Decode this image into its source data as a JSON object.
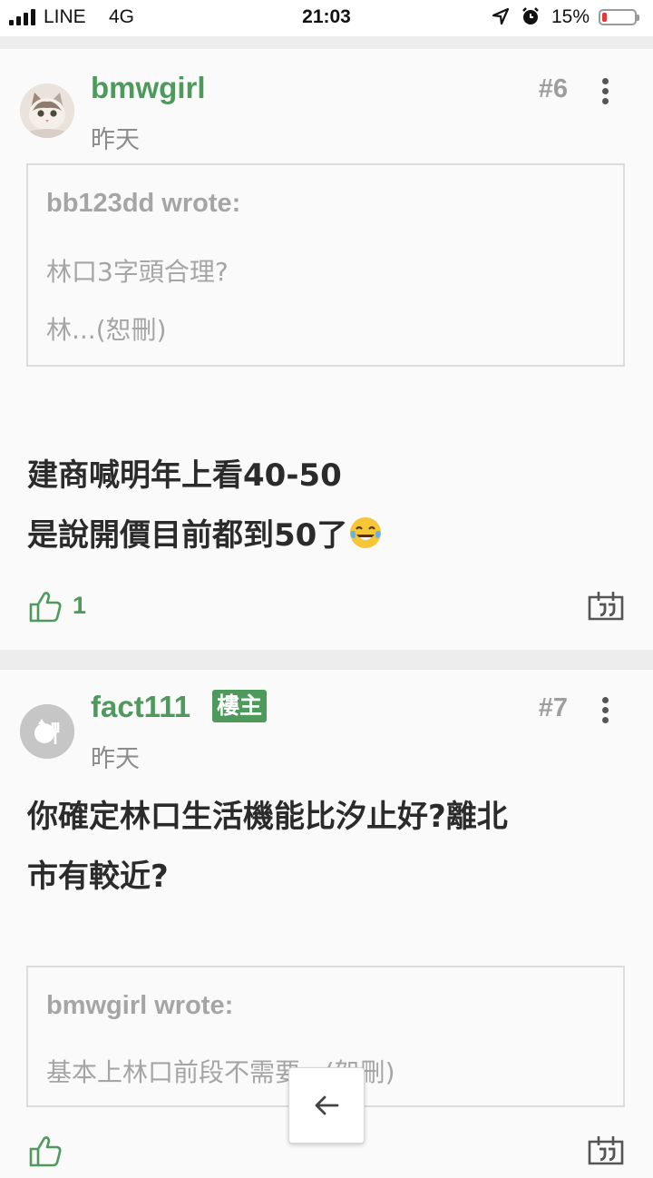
{
  "status_bar": {
    "carrier": "LINE",
    "network": "4G",
    "time": "21:03",
    "battery": "15%",
    "battery_level": 0.15
  },
  "posts": [
    {
      "username": "bmwgirl",
      "time": "昨天",
      "floor": "#6",
      "quote": {
        "author": "bb123dd wrote:",
        "lines": [
          "林口3字頭合理?",
          "林...(恕刪)"
        ]
      },
      "body": [
        "建商喊明年上看40-50",
        "是說開價目前都到50了"
      ],
      "likes": "1"
    },
    {
      "username": "fact111",
      "badge": "樓主",
      "time": "昨天",
      "floor": "#7",
      "body": [
        "你確定林口生活機能比汐止好?離北",
        "市有較近?"
      ],
      "quote": {
        "author": "bmwgirl wrote:",
        "lines": [
          "基本上林口前段不需要...(恕刪)"
        ]
      }
    }
  ],
  "colors": {
    "accent_green": "#4e9a5c",
    "muted_gray": "#a5a5a5",
    "battery_red": "#e53935"
  },
  "icons": [
    "signal-icon",
    "location-arrow-icon",
    "alarm-clock-icon",
    "battery-icon",
    "more-vertical-icon",
    "thumbs-up-icon",
    "quote-reply-icon",
    "laughing-tears-emoji",
    "arrow-left-icon"
  ]
}
